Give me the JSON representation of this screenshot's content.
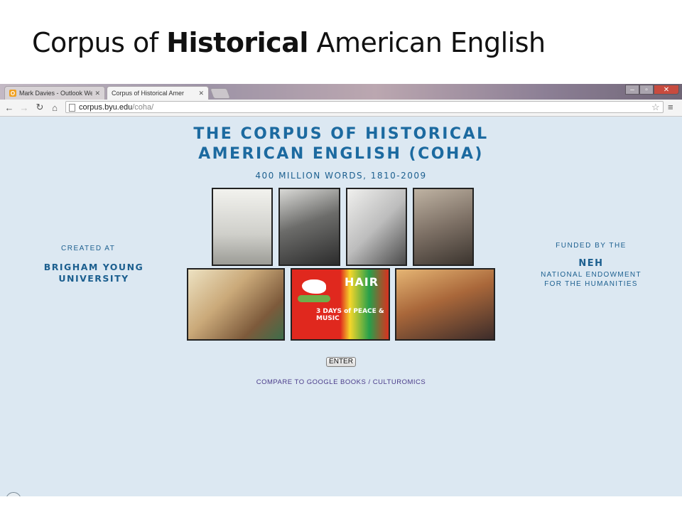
{
  "slide": {
    "title_pre": "Corpus of ",
    "title_bold": "Historical",
    "title_post": " American English"
  },
  "browser": {
    "tabs": [
      {
        "label": "Mark Davies - Outlook We",
        "icon": "outlook-icon",
        "active": false
      },
      {
        "label": "Corpus of Historical Amer",
        "icon": "page-icon",
        "active": true
      }
    ],
    "window_controls": [
      "minimize",
      "maximize",
      "close"
    ],
    "url_host": "corpus.byu.edu",
    "url_path": "/coha/"
  },
  "page": {
    "heading_line1": "THE CORPUS OF HISTORICAL",
    "heading_line2": "AMERICAN ENGLISH (COHA)",
    "subtitle": "400 MILLION WORDS, 1810-2009",
    "created_label": "CREATED AT",
    "created_by": "BRIGHAM YOUNG UNIVERSITY",
    "funded_label": "FUNDED BY THE",
    "funder_abbrev": "NEH",
    "funder_full": "NATIONAL ENDOWMENT FOR THE HUMANITIES",
    "enter_label": "ENTER",
    "compare_link": "COMPARE TO GOOGLE BOOKS / CULTUROMICS",
    "poster_hair": "HAIR",
    "poster_days": "3 DAYS of PEACE & MUSIC"
  },
  "colors": {
    "heading": "#1c6aa0",
    "page_bg": "#dce8f2",
    "link": "#4a3b8a"
  }
}
